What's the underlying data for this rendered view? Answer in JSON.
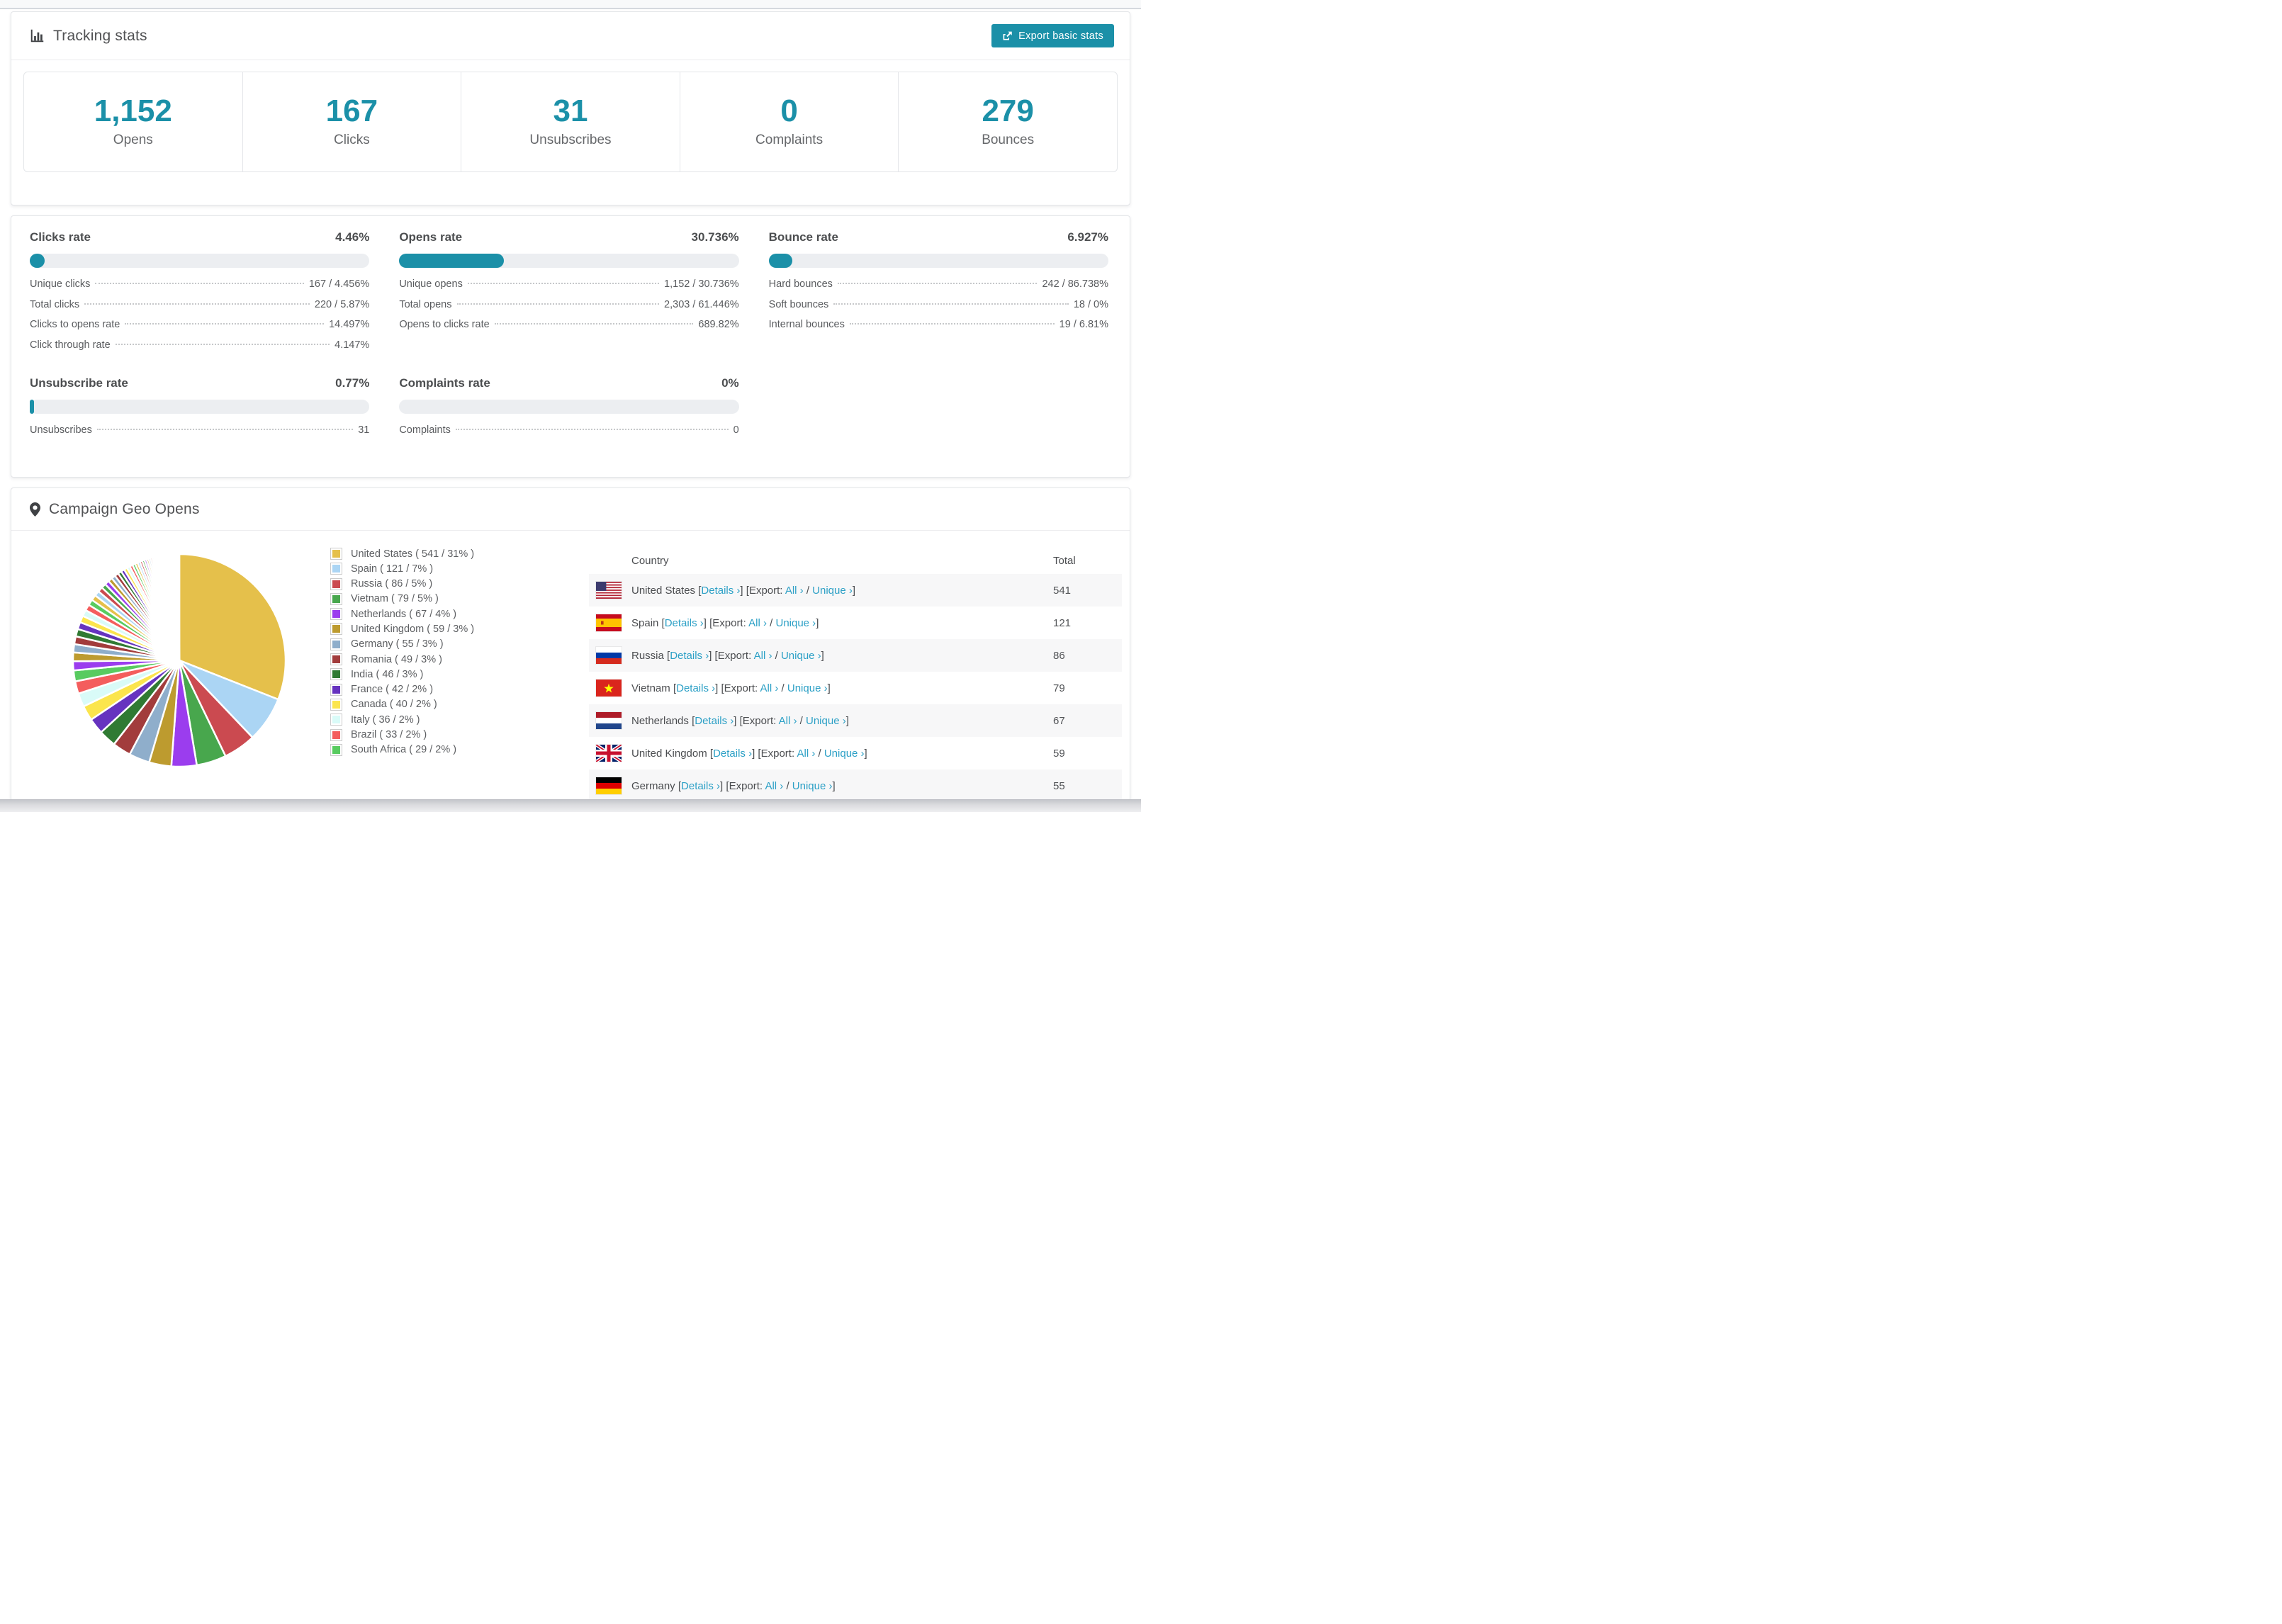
{
  "colors": {
    "accent": "#1B90A8",
    "link": "#2CA0C6",
    "track": "#ECEEF1"
  },
  "tracking": {
    "title": "Tracking stats",
    "export_button": "Export basic stats",
    "stats": [
      {
        "label": "Opens",
        "value": "1,152"
      },
      {
        "label": "Clicks",
        "value": "167"
      },
      {
        "label": "Unsubscribes",
        "value": "31"
      },
      {
        "label": "Complaints",
        "value": "0"
      },
      {
        "label": "Bounces",
        "value": "279"
      }
    ]
  },
  "rates": [
    {
      "title": "Clicks rate",
      "value": "4.46%",
      "percent": 4.46,
      "rows": [
        {
          "label": "Unique clicks",
          "value": "167 / 4.456%"
        },
        {
          "label": "Total clicks",
          "value": "220 / 5.87%"
        },
        {
          "label": "Clicks to opens rate",
          "value": "14.497%"
        },
        {
          "label": "Click through rate",
          "value": "4.147%"
        }
      ]
    },
    {
      "title": "Opens rate",
      "value": "30.736%",
      "percent": 30.736,
      "rows": [
        {
          "label": "Unique opens",
          "value": "1,152 / 30.736%"
        },
        {
          "label": "Total opens",
          "value": "2,303 / 61.446%"
        },
        {
          "label": "Opens to clicks rate",
          "value": "689.82%"
        }
      ]
    },
    {
      "title": "Bounce rate",
      "value": "6.927%",
      "percent": 6.927,
      "rows": [
        {
          "label": "Hard bounces",
          "value": "242 / 86.738%"
        },
        {
          "label": "Soft bounces",
          "value": "18 / 0%"
        },
        {
          "label": "Internal bounces",
          "value": "19 / 6.81%"
        }
      ]
    },
    {
      "title": "Unsubscribe rate",
      "value": "0.77%",
      "percent": 0.77,
      "rows": [
        {
          "label": "Unsubscribes",
          "value": "31"
        }
      ]
    },
    {
      "title": "Complaints rate",
      "value": "0%",
      "percent": 0,
      "rows": [
        {
          "label": "Complaints",
          "value": "0"
        }
      ]
    }
  ],
  "geo": {
    "title": "Campaign Geo Opens",
    "table_headers": {
      "country": "Country",
      "total": "Total"
    },
    "link_labels": {
      "details": "Details ›",
      "export": "Export:",
      "all": "All ›",
      "unique": "Unique ›",
      "open_bracket": "[",
      "close_bracket": "]",
      "separator": "/"
    },
    "rows": [
      {
        "country": "United States",
        "flag": "us",
        "total": "541"
      },
      {
        "country": "Spain",
        "flag": "es",
        "total": "121"
      },
      {
        "country": "Russia",
        "flag": "ru",
        "total": "86"
      },
      {
        "country": "Vietnam",
        "flag": "vn",
        "total": "79"
      },
      {
        "country": "Netherlands",
        "flag": "nl",
        "total": "67"
      },
      {
        "country": "United Kingdom",
        "flag": "gb",
        "total": "59"
      },
      {
        "country": "Germany",
        "flag": "de",
        "total": "55"
      }
    ]
  },
  "chart_data": {
    "type": "pie",
    "title": "Campaign Geo Opens",
    "unit": "opens",
    "legend_position": "right",
    "start_angle_deg": -90,
    "direction": "clockwise",
    "slice_gap_color": "#ffffff",
    "series": [
      {
        "name": "United States",
        "value": 541,
        "percent_label": "31%",
        "color": "#E5C04B",
        "legend_label": "United States ( 541 / 31% )"
      },
      {
        "name": "Spain",
        "value": 121,
        "percent_label": "7%",
        "color": "#ABD5F4",
        "legend_label": "Spain ( 121 / 7% )"
      },
      {
        "name": "Russia",
        "value": 86,
        "percent_label": "5%",
        "color": "#CB4A50",
        "legend_label": "Russia ( 86 / 5% )"
      },
      {
        "name": "Vietnam",
        "value": 79,
        "percent_label": "5%",
        "color": "#48A74D",
        "legend_label": "Vietnam ( 79 / 5% )"
      },
      {
        "name": "Netherlands",
        "value": 67,
        "percent_label": "4%",
        "color": "#9B3DEE",
        "legend_label": "Netherlands ( 67 / 4% )"
      },
      {
        "name": "United Kingdom",
        "value": 59,
        "percent_label": "3%",
        "color": "#BD9B2F",
        "legend_label": "United Kingdom ( 59 / 3% )"
      },
      {
        "name": "Germany",
        "value": 55,
        "percent_label": "3%",
        "color": "#8FAECB",
        "legend_label": "Germany ( 55 / 3% )"
      },
      {
        "name": "Romania",
        "value": 49,
        "percent_label": "3%",
        "color": "#A23C3C",
        "legend_label": "Romania ( 49 / 3% )"
      },
      {
        "name": "India",
        "value": 46,
        "percent_label": "3%",
        "color": "#307A33",
        "legend_label": "India ( 46 / 3% )"
      },
      {
        "name": "France",
        "value": 42,
        "percent_label": "2%",
        "color": "#6633BF",
        "legend_label": "France ( 42 / 2% )"
      },
      {
        "name": "Canada",
        "value": 40,
        "percent_label": "2%",
        "color": "#FBE54D",
        "legend_label": "Canada ( 40 / 2% )"
      },
      {
        "name": "Italy",
        "value": 36,
        "percent_label": "2%",
        "color": "#D9FBF8",
        "legend_label": "Italy ( 36 / 2% )"
      },
      {
        "name": "Brazil",
        "value": 33,
        "percent_label": "2%",
        "color": "#F45D5D",
        "legend_label": "Brazil ( 33 / 2% )"
      },
      {
        "name": "South Africa",
        "value": 29,
        "percent_label": "2%",
        "color": "#58CB60",
        "legend_label": "South Africa ( 29 / 2% )"
      }
    ],
    "others": {
      "note": "remainder of opens drawn as many small unlabeled slices shrinking toward 12 o'clock",
      "estimated_total": 463,
      "estimated_percent": 26.5
    }
  }
}
